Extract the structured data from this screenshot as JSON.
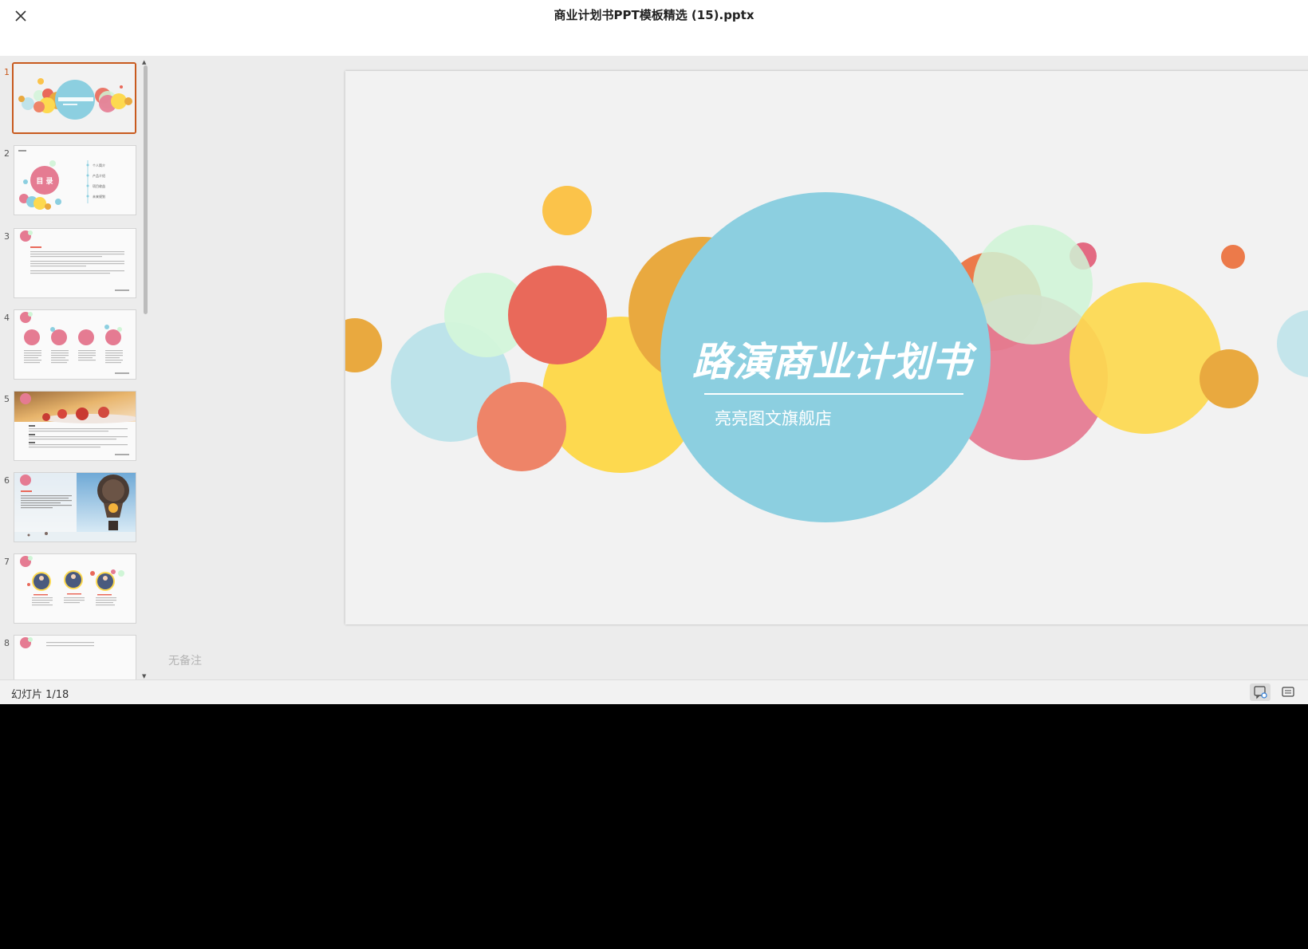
{
  "window": {
    "title": "商业计划书PPT模板精选 (15).pptx"
  },
  "icons": {
    "close": "close-icon",
    "notes": "notes-view-icon",
    "subtitles": "keyboard-icon"
  },
  "thumbnails": [
    {
      "number": "1",
      "active": true
    },
    {
      "number": "2",
      "title": "目 录",
      "items": [
        "个人简介",
        "产品介绍",
        "项目收益",
        "未来规划"
      ]
    },
    {
      "number": "3"
    },
    {
      "number": "4"
    },
    {
      "number": "5"
    },
    {
      "number": "6"
    },
    {
      "number": "7"
    },
    {
      "number": "8"
    }
  ],
  "slide": {
    "title": "路演商业计划书",
    "subtitle": "亮亮图文旗舰店"
  },
  "notes": {
    "text": "无备注"
  },
  "status": {
    "counter": "幻灯片 1/18"
  },
  "colors": {
    "accent": "#c85a1e",
    "blue": "#8ccfe0",
    "yellow": "#fdd94f",
    "orange": "#e9a93f",
    "red": "#e9695a",
    "pink": "#e57b92",
    "mint": "#cff5d6"
  }
}
